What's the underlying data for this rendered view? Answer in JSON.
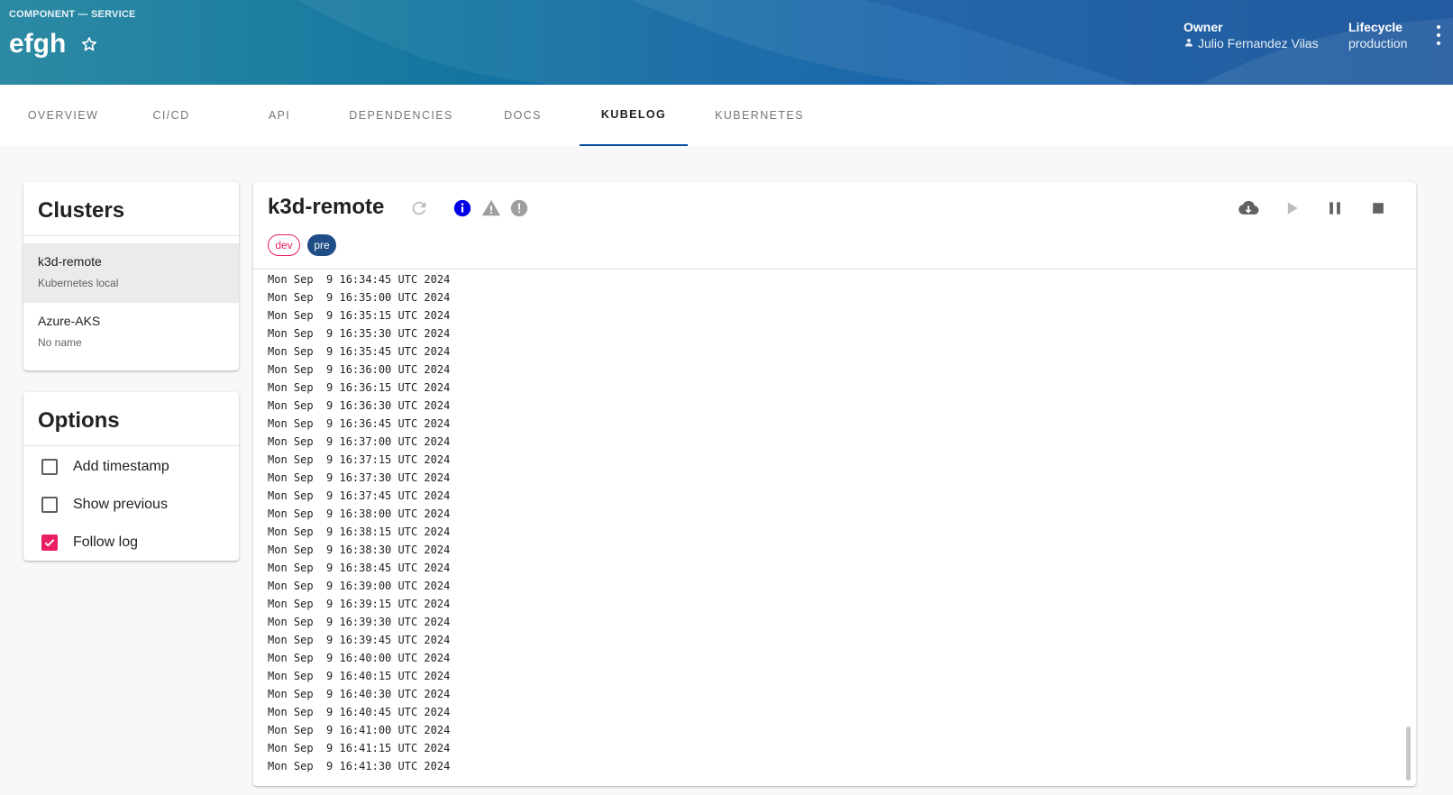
{
  "header": {
    "kicker": "COMPONENT — SERVICE",
    "title": "efgh",
    "owner_label": "Owner",
    "owner_value": "Julio Fernandez Vilas",
    "lifecycle_label": "Lifecycle",
    "lifecycle_value": "production"
  },
  "tabs": [
    {
      "label": "OVERVIEW"
    },
    {
      "label": "CI/CD"
    },
    {
      "label": "API"
    },
    {
      "label": "DEPENDENCIES"
    },
    {
      "label": "DOCS"
    },
    {
      "label": "KUBELOG",
      "active": true
    },
    {
      "label": "KUBERNETES"
    }
  ],
  "clusters": {
    "title": "Clusters",
    "items": [
      {
        "name": "k3d-remote",
        "desc": "Kubernetes local",
        "selected": true
      },
      {
        "name": "Azure-AKS",
        "desc": "No name"
      }
    ]
  },
  "options": {
    "title": "Options",
    "items": [
      {
        "label": "Add timestamp",
        "checked": false
      },
      {
        "label": "Show previous",
        "checked": false
      },
      {
        "label": "Follow log",
        "checked": true
      }
    ]
  },
  "log": {
    "cluster": "k3d-remote",
    "tags": [
      "dev",
      "pre"
    ],
    "icons": {
      "refresh": "refresh-icon",
      "info": "info-icon",
      "warning": "warning-icon",
      "error": "error-icon",
      "download": "cloud-download-icon",
      "play": "play-icon",
      "pause": "pause-icon",
      "stop": "stop-icon"
    },
    "colors": {
      "info": "#0000e6",
      "accent": "#e91e63",
      "header": "#0a4f9c"
    },
    "lines": [
      "Mon Sep  9 16:34:45 UTC 2024",
      "Mon Sep  9 16:35:00 UTC 2024",
      "Mon Sep  9 16:35:15 UTC 2024",
      "Mon Sep  9 16:35:30 UTC 2024",
      "Mon Sep  9 16:35:45 UTC 2024",
      "Mon Sep  9 16:36:00 UTC 2024",
      "Mon Sep  9 16:36:15 UTC 2024",
      "Mon Sep  9 16:36:30 UTC 2024",
      "Mon Sep  9 16:36:45 UTC 2024",
      "Mon Sep  9 16:37:00 UTC 2024",
      "Mon Sep  9 16:37:15 UTC 2024",
      "Mon Sep  9 16:37:30 UTC 2024",
      "Mon Sep  9 16:37:45 UTC 2024",
      "Mon Sep  9 16:38:00 UTC 2024",
      "Mon Sep  9 16:38:15 UTC 2024",
      "Mon Sep  9 16:38:30 UTC 2024",
      "Mon Sep  9 16:38:45 UTC 2024",
      "Mon Sep  9 16:39:00 UTC 2024",
      "Mon Sep  9 16:39:15 UTC 2024",
      "Mon Sep  9 16:39:30 UTC 2024",
      "Mon Sep  9 16:39:45 UTC 2024",
      "Mon Sep  9 16:40:00 UTC 2024",
      "Mon Sep  9 16:40:15 UTC 2024",
      "Mon Sep  9 16:40:30 UTC 2024",
      "Mon Sep  9 16:40:45 UTC 2024",
      "Mon Sep  9 16:41:00 UTC 2024",
      "Mon Sep  9 16:41:15 UTC 2024",
      "Mon Sep  9 16:41:30 UTC 2024"
    ]
  }
}
